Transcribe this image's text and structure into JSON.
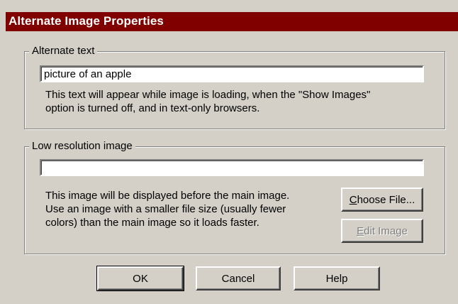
{
  "window": {
    "title": "Alternate Image Properties"
  },
  "alternate_text": {
    "legend": "Alternate text",
    "value": "picture of an apple",
    "help_lines": [
      "This text will appear while image is loading, when the \"Show Images\"",
      "option is turned off, and in text-only browsers."
    ]
  },
  "low_res": {
    "legend": "Low resolution image",
    "value": "",
    "help_lines": [
      "This image will be displayed before the main image.",
      "Use an image with a smaller file size (usually fewer",
      "colors) than the main image so it loads faster."
    ],
    "choose_file": {
      "mnemonic": "C",
      "rest": "hoose File..."
    },
    "edit_image": {
      "mnemonic": "E",
      "rest": "dit Image",
      "enabled": false
    }
  },
  "buttons": {
    "ok": "OK",
    "cancel": "Cancel",
    "help": "Help"
  }
}
